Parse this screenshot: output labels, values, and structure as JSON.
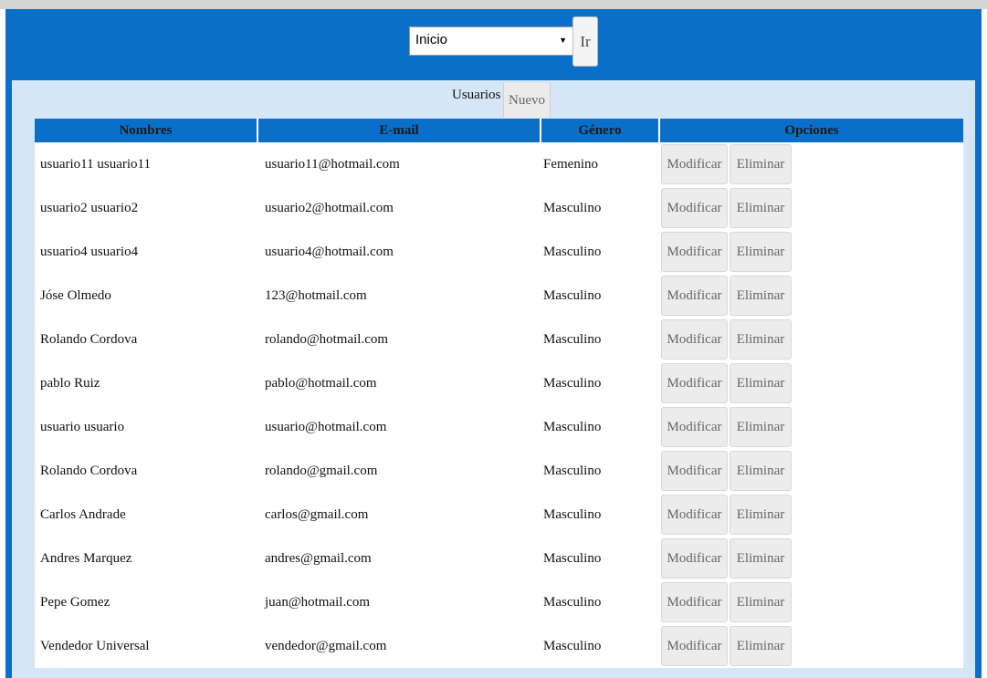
{
  "nav": {
    "select_value": "Inicio",
    "go_label": "Ir"
  },
  "section": {
    "title": "Usuarios",
    "new_label": "Nuevo"
  },
  "table": {
    "headers": [
      "Nombres",
      "E-mail",
      "Género",
      "Opciones"
    ],
    "modify_label": "Modificar",
    "delete_label": "Eliminar",
    "rows": [
      {
        "name": "usuario11 usuario11",
        "email": "usuario11@hotmail.com",
        "gender": "Femenino"
      },
      {
        "name": "usuario2 usuario2",
        "email": "usuario2@hotmail.com",
        "gender": "Masculino"
      },
      {
        "name": "usuario4 usuario4",
        "email": "usuario4@hotmail.com",
        "gender": "Masculino"
      },
      {
        "name": "Jóse Olmedo",
        "email": "123@hotmail.com",
        "gender": "Masculino"
      },
      {
        "name": "Rolando Cordova",
        "email": "rolando@hotmail.com",
        "gender": "Masculino"
      },
      {
        "name": "pablo Ruiz",
        "email": "pablo@hotmail.com",
        "gender": "Masculino"
      },
      {
        "name": "usuario usuario",
        "email": "usuario@hotmail.com",
        "gender": "Masculino"
      },
      {
        "name": "Rolando Cordova",
        "email": "rolando@gmail.com",
        "gender": "Masculino"
      },
      {
        "name": "Carlos Andrade",
        "email": "carlos@gmail.com",
        "gender": "Masculino"
      },
      {
        "name": "Andres Marquez",
        "email": "andres@gmail.com",
        "gender": "Masculino"
      },
      {
        "name": "Pepe Gomez",
        "email": "juan@hotmail.com",
        "gender": "Masculino"
      },
      {
        "name": "Vendedor Universal",
        "email": "vendedor@gmail.com",
        "gender": "Masculino"
      }
    ]
  },
  "colors": {
    "primary_blue": "#0a6fc9",
    "panel_background": "#d5e6f7"
  }
}
